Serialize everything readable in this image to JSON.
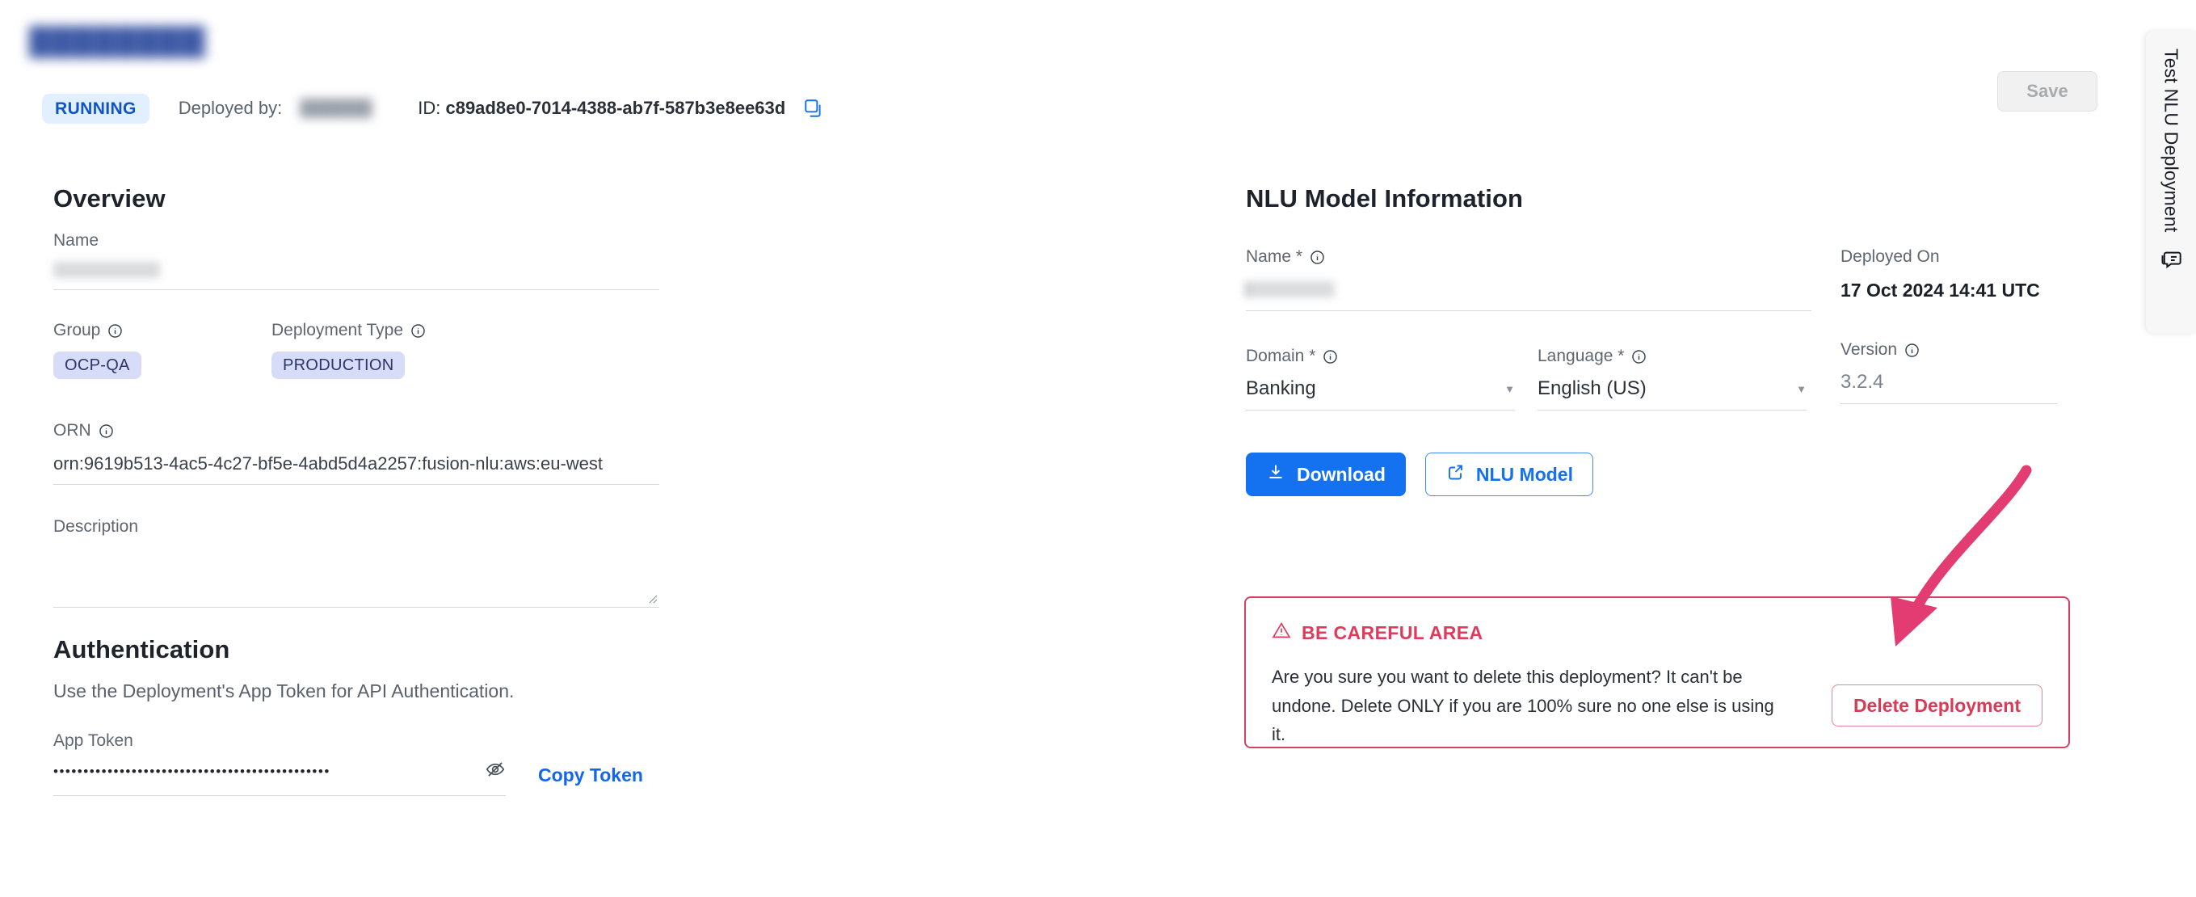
{
  "header": {
    "title_redacted": "█████████",
    "status_badge": "RUNNING",
    "deployed_by_label": "Deployed by:",
    "deployed_by_value_redacted": "██████",
    "id_prefix": "ID:",
    "id_value": "c89ad8e0-7014-4388-ab7f-587b3e8ee63d",
    "copy_icon": "copy-icon",
    "save_label": "Save"
  },
  "side_tab": {
    "label": "Test NLU Deployment",
    "icon": "chat-test-icon"
  },
  "overview": {
    "heading": "Overview",
    "name_label": "Name",
    "name_value_redacted": "███████",
    "group_label": "Group",
    "group_value": "OCP-QA",
    "deployment_type_label": "Deployment Type",
    "deployment_type_value": "PRODUCTION",
    "orn_label": "ORN",
    "orn_value": "orn:9619b513-4ac5-4c27-bf5e-4abd5d4a2257:fusion-nlu:aws:eu-west",
    "description_label": "Description",
    "description_value": "",
    "info_icon": "info-icon"
  },
  "authentication": {
    "heading": "Authentication",
    "subtitle": "Use the Deployment's App Token for API Authentication.",
    "app_token_label": "App Token",
    "app_token_masked": "••••••••••••••••••••••••••••••••••••••••••••••",
    "eye_icon": "eye-off-icon",
    "copy_token_label": "Copy Token"
  },
  "nlu_model": {
    "heading": "NLU Model Information",
    "name_label": "Name *",
    "name_value_redacted": "█████",
    "domain_label": "Domain *",
    "domain_value": "Banking",
    "language_label": "Language *",
    "language_value": "English (US)",
    "deployed_on_label": "Deployed On",
    "deployed_on_value": "17 Oct 2024 14:41 UTC",
    "version_label": "Version",
    "version_value": "3.2.4",
    "download_label": "Download",
    "download_icon": "download-icon",
    "nlu_model_label": "NLU Model",
    "nlu_model_icon": "external-link-icon",
    "caret_icon": "chevron-down-icon"
  },
  "danger_zone": {
    "heading": "BE CAREFUL AREA",
    "warning_icon": "warning-triangle-icon",
    "body": "Are you sure you want to delete this deployment? It can't be undone. Delete ONLY if you are 100% sure no one else is using it.",
    "delete_label": "Delete Deployment"
  },
  "annotation": {
    "arrow_icon": "curved-arrow-annotation",
    "arrow_color": "#e23c72"
  },
  "colors": {
    "accent_blue": "#1472f0",
    "status_badge_bg": "#e2efff",
    "status_badge_text": "#1155c4",
    "chip_bg": "#d7ddf8",
    "chip_text": "#2c3566",
    "danger_red": "#d94060",
    "annotation_pink": "#e23c72"
  }
}
